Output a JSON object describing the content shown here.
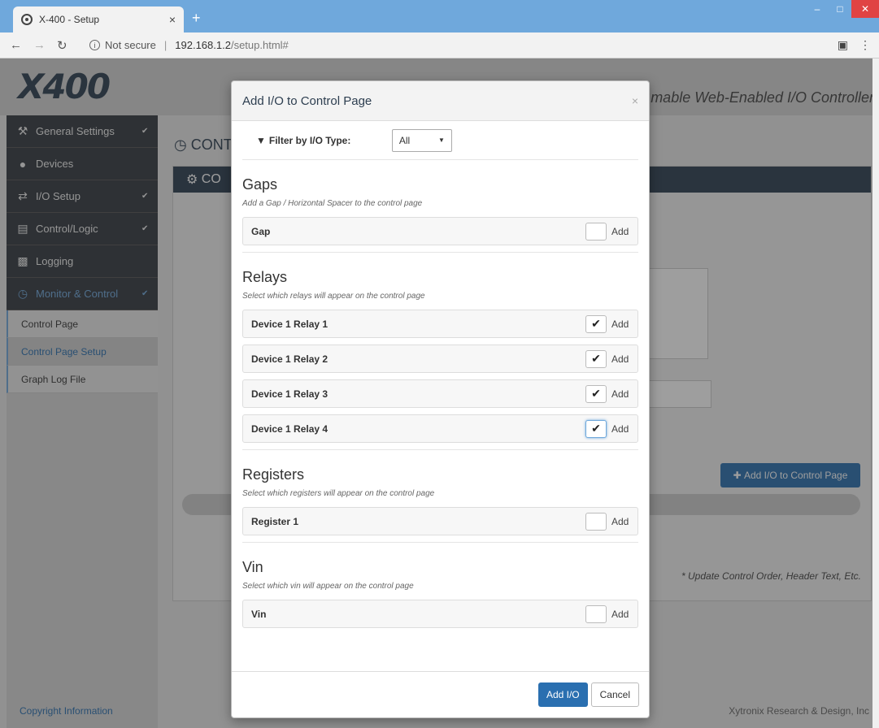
{
  "browser": {
    "tab_title": "X-400 - Setup",
    "tab_close": "×",
    "new_tab": "+",
    "security": "Not secure",
    "host": "192.168.1.2",
    "path": "/setup.html#"
  },
  "page": {
    "logo": "X400",
    "tagline": "mable Web-Enabled I/O Controller",
    "content_heading": "CONT",
    "panel_heading": "CO",
    "add_io_button": "Add I/O to Control Page",
    "note": "* Update Control Order, Header Text, Etc.",
    "copyright": "Copyright Information",
    "company": "Xytronix Research & Design, Inc"
  },
  "sidebar": {
    "items": [
      {
        "label": "General Settings",
        "icon": "wrench-icon"
      },
      {
        "label": "Devices",
        "icon": "globe-icon"
      },
      {
        "label": "I/O Setup",
        "icon": "exchange-icon"
      },
      {
        "label": "Control/Logic",
        "icon": "server-icon"
      },
      {
        "label": "Logging",
        "icon": "chart-icon"
      },
      {
        "label": "Monitor & Control",
        "icon": "dashboard-icon"
      }
    ],
    "subitems": [
      "Control Page",
      "Control Page Setup",
      "Graph Log File"
    ]
  },
  "modal": {
    "title": "Add I/O to Control Page",
    "close": "×",
    "filter_label": "Filter by I/O Type:",
    "filter_value": "All",
    "sections": [
      {
        "title": "Gaps",
        "desc": "Add a Gap / Horizontal Spacer to the control page",
        "rows": [
          {
            "label": "Gap",
            "checked": false
          }
        ]
      },
      {
        "title": "Relays",
        "desc": "Select which relays will appear on the control page",
        "rows": [
          {
            "label": "Device 1 Relay 1",
            "checked": true
          },
          {
            "label": "Device 1 Relay 2",
            "checked": true
          },
          {
            "label": "Device 1 Relay 3",
            "checked": true
          },
          {
            "label": "Device 1 Relay 4",
            "checked": true
          }
        ]
      },
      {
        "title": "Registers",
        "desc": "Select which registers will appear on the control page",
        "rows": [
          {
            "label": "Register 1",
            "checked": false
          }
        ]
      },
      {
        "title": "Vin",
        "desc": "Select which vin will appear on the control page",
        "rows": [
          {
            "label": "Vin",
            "checked": false
          }
        ]
      }
    ],
    "add_label": "Add",
    "primary_button": "Add I/O",
    "cancel_button": "Cancel"
  }
}
